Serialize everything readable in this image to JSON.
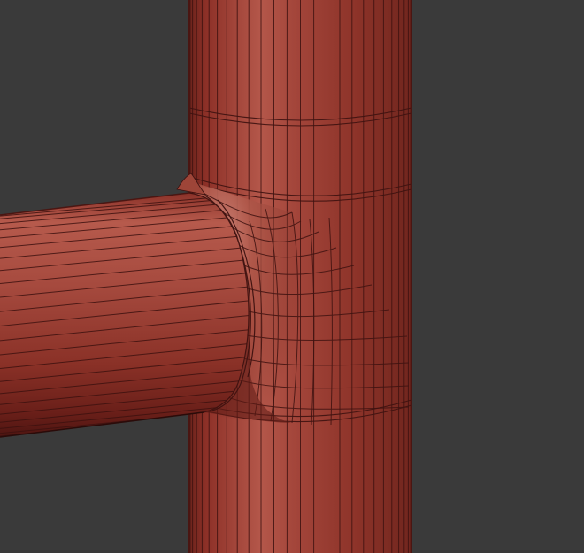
{
  "viewport": {
    "background_color": "#3a3a3a"
  },
  "model": {
    "description_name": "t-junction-pipe",
    "base_color": "#9a3a30",
    "wire_color": "#3e1210",
    "parts": [
      {
        "name": "vertical-pipe"
      },
      {
        "name": "horizontal-pipe"
      },
      {
        "name": "junction-fillet"
      }
    ]
  }
}
